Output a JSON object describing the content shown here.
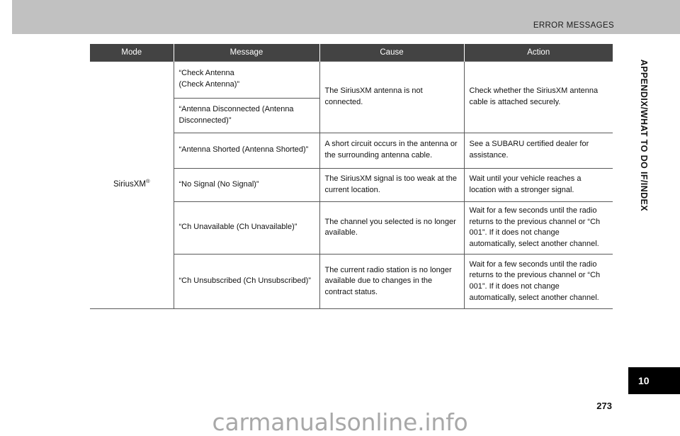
{
  "header": {
    "title": "ERROR MESSAGES"
  },
  "table": {
    "columns": [
      "Mode",
      "Message",
      "Cause",
      "Action"
    ],
    "mode_label": "SiriusXM",
    "mode_superscript": "®",
    "rows": [
      {
        "message": "“Check Antenna\n (Check Antenna)”",
        "cause": "The SiriusXM antenna is not connected.",
        "action": "Check whether the SiriusXM antenna cable is attached securely."
      },
      {
        "message": "“Antenna Disconnected (Antenna Disconnected)”",
        "cause": "",
        "action": ""
      },
      {
        "message": "“Antenna Shorted (Antenna Shorted)”",
        "cause": "A short circuit occurs in the antenna or the surrounding antenna cable.",
        "action": "See a SUBARU certified dealer for assistance."
      },
      {
        "message": "“No Signal (No Signal)”",
        "cause": "The SiriusXM signal is too weak at the current location.",
        "action": "Wait until your vehicle reaches a location with a stronger signal."
      },
      {
        "message": "“Ch Unavailable (Ch Unavailable)”",
        "cause": "The channel you selected is no longer available.",
        "action": "Wait for a few seconds until the radio returns to the previous channel or “Ch 001”. If it does not change automatically, select another channel."
      },
      {
        "message": "“Ch Unsubscribed (Ch Unsubscribed)”",
        "cause": "The current radio station is no longer available due to changes in the contract status.",
        "action": "Wait for a few seconds until the radio returns to the previous channel or “Ch 001”. If it does not change automatically, select another channel."
      }
    ]
  },
  "side_tab": {
    "vertical_label": "APPENDIX/WHAT TO DO IF/INDEX",
    "chapter_number": "10"
  },
  "footer": {
    "page_number": "273",
    "watermark": "carmanualsonline.info"
  },
  "colors": {
    "header_band": "#c1c1c1",
    "table_header": "#434343",
    "table_border": "#5a5a5a",
    "chapter_tab": "#000000",
    "watermark": "#a8a8a8"
  }
}
